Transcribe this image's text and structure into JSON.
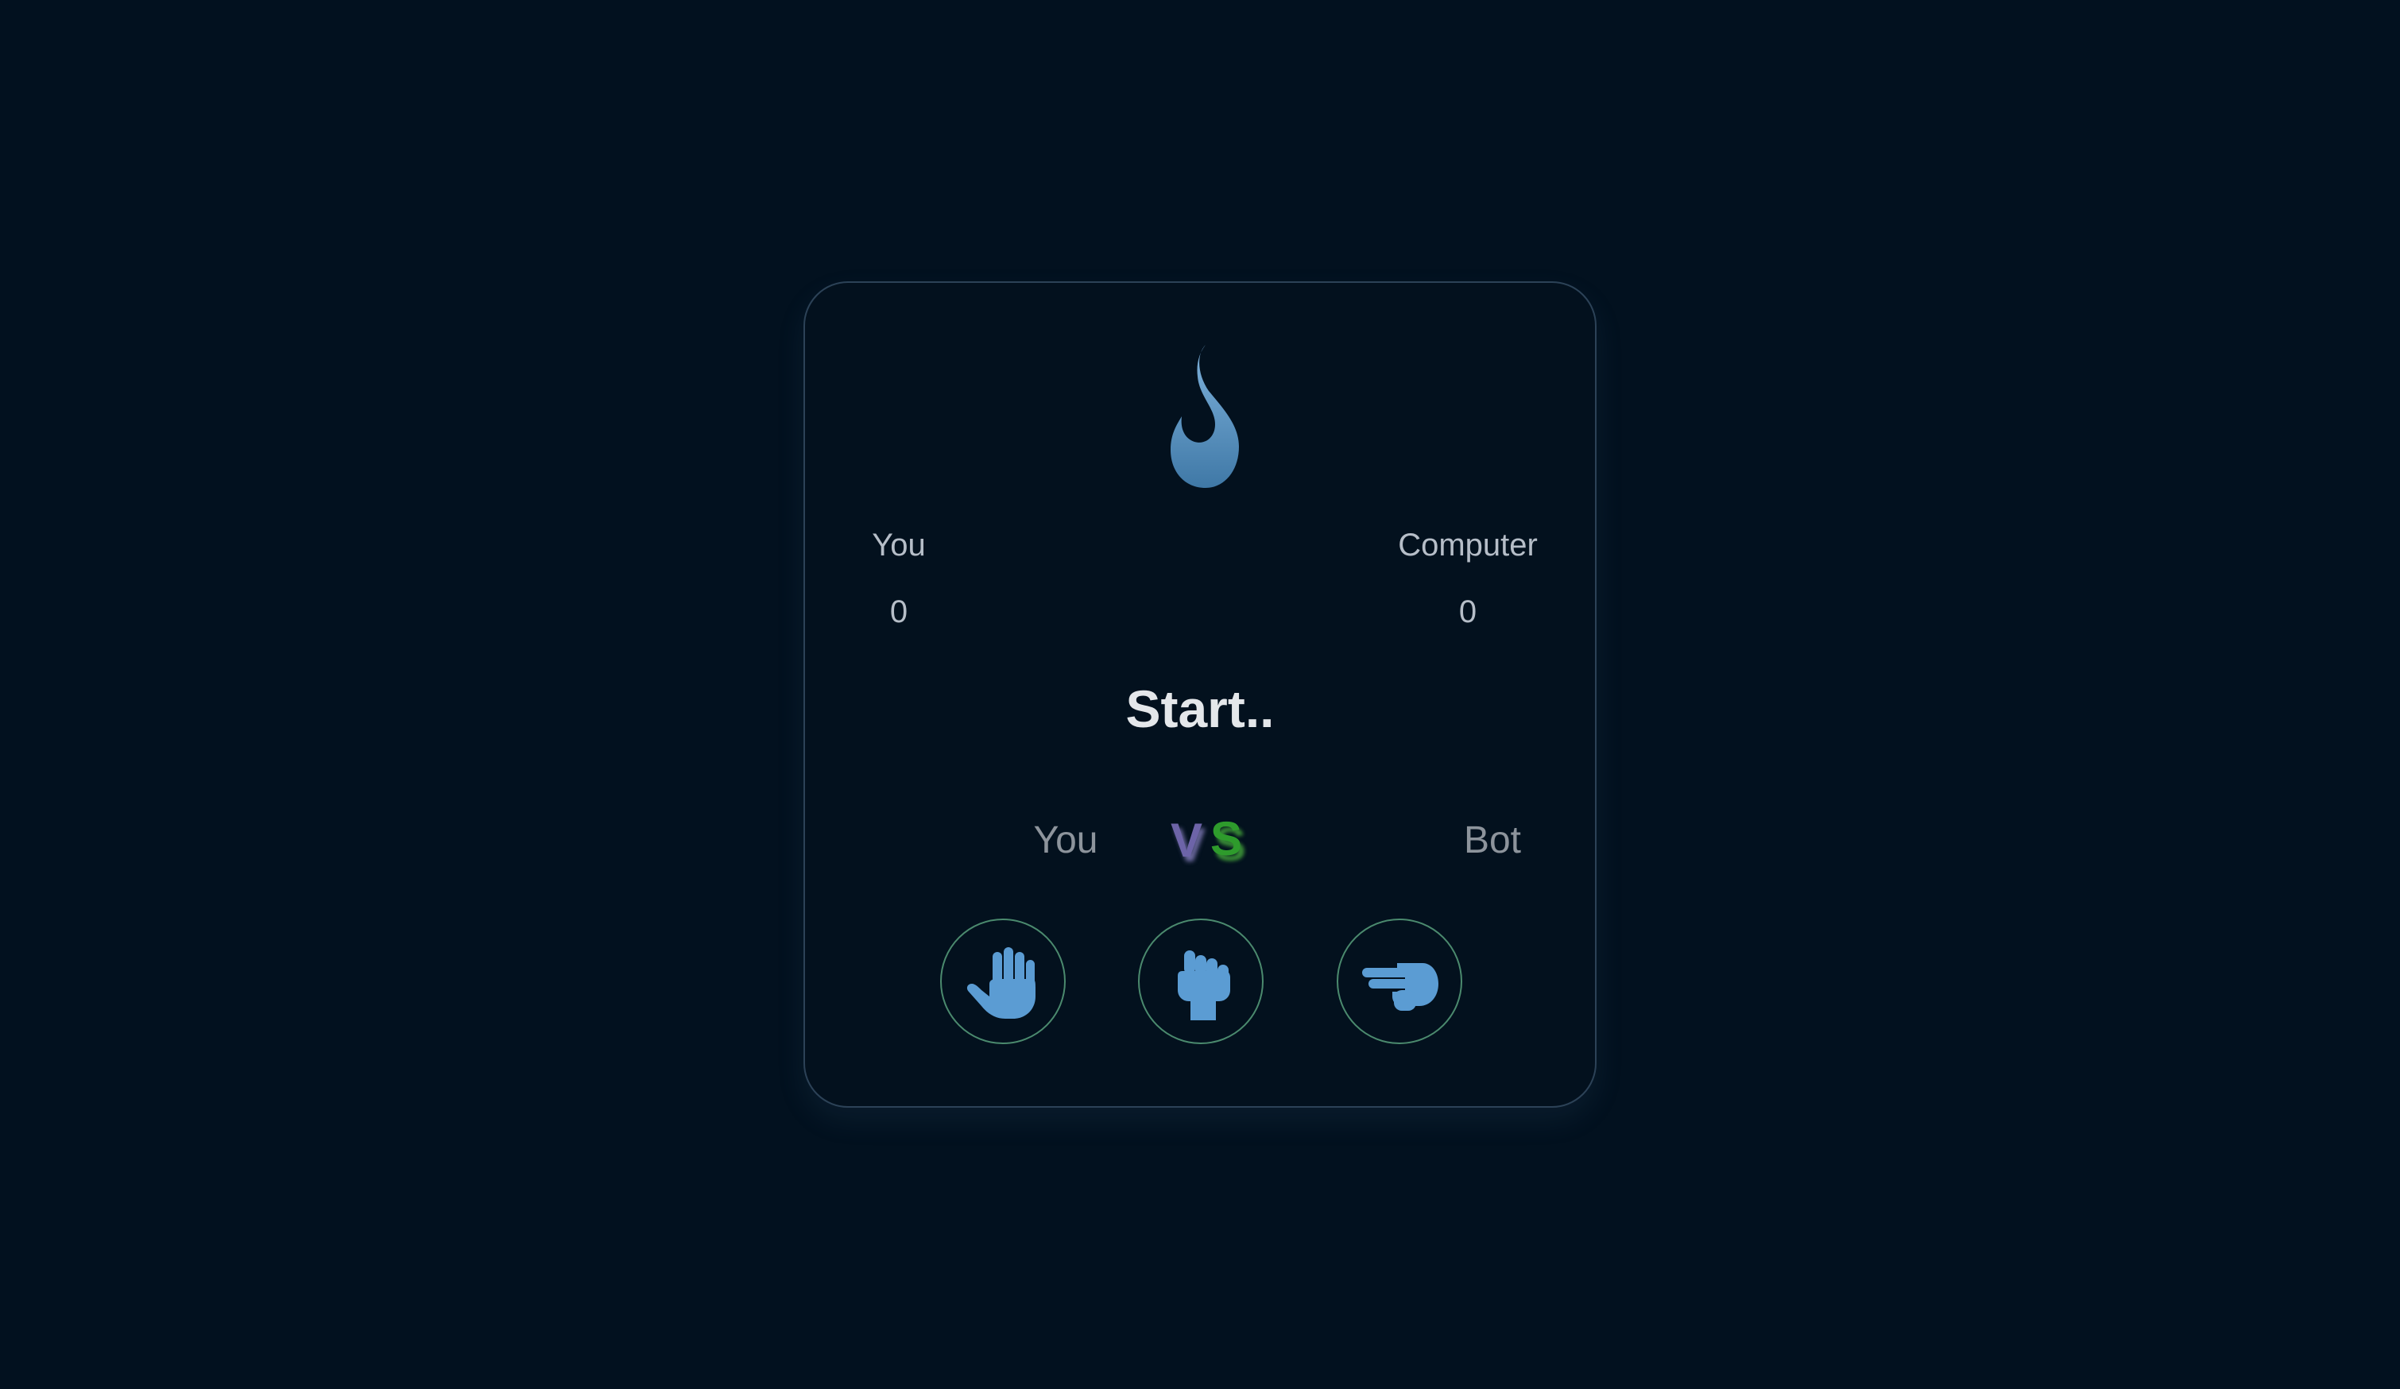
{
  "game": {
    "logo_icon": "blue-flame-icon",
    "status": "Start..",
    "accent_color": "#5b9cd3",
    "button_border_color": "#4b8a6e"
  },
  "scoreboard": {
    "you_label": "You",
    "you_score": "0",
    "computer_label": "Computer",
    "computer_score": "0"
  },
  "versus": {
    "left_label": "You",
    "v": "V",
    "s": "S",
    "right_label": "Bot"
  },
  "choices": [
    {
      "name": "paper",
      "icon": "open-hand-icon"
    },
    {
      "name": "rock",
      "icon": "fist-icon"
    },
    {
      "name": "scissors",
      "icon": "two-finger-hand-icon"
    }
  ]
}
